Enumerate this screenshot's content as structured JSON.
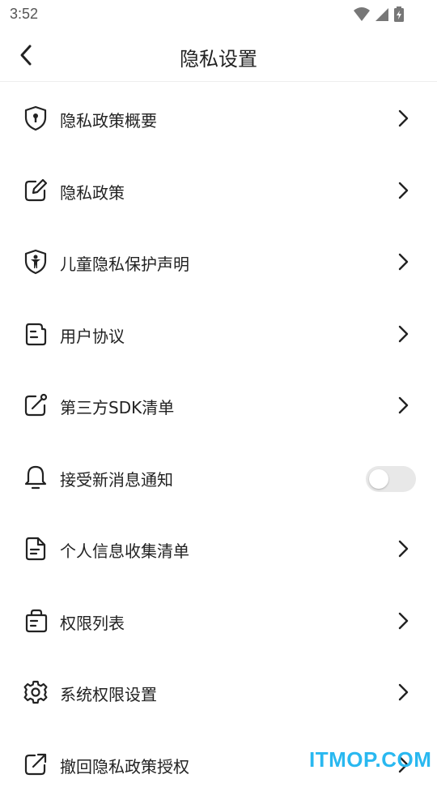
{
  "status_bar": {
    "time": "3:52",
    "icons": [
      "wifi-icon",
      "signal-icon",
      "battery-icon"
    ]
  },
  "header": {
    "back_icon": "chevron-left-icon",
    "title": "隐私设置"
  },
  "settings": {
    "items": [
      {
        "label": "隐私政策概要",
        "icon": "shield-lock-icon",
        "control": "chevron"
      },
      {
        "label": "隐私政策",
        "icon": "edit-note-icon",
        "control": "chevron"
      },
      {
        "label": "儿童隐私保护声明",
        "icon": "child-shield-icon",
        "control": "chevron"
      },
      {
        "label": "用户协议",
        "icon": "document-icon",
        "control": "chevron"
      },
      {
        "label": "第三方SDK清单",
        "icon": "external-edit-icon",
        "control": "chevron"
      },
      {
        "label": "接受新消息通知",
        "icon": "bell-icon",
        "control": "toggle",
        "toggle_on": false
      },
      {
        "label": "个人信息收集清单",
        "icon": "file-list-icon",
        "control": "chevron"
      },
      {
        "label": "权限列表",
        "icon": "bag-icon",
        "control": "chevron"
      },
      {
        "label": "系统权限设置",
        "icon": "gear-icon",
        "control": "chevron"
      },
      {
        "label": "撤回隐私政策授权",
        "icon": "share-out-icon",
        "control": "chevron"
      }
    ]
  },
  "watermark": {
    "text": "ITMOP.COM",
    "color": "#29b8f0"
  },
  "colors": {
    "text": "#222222",
    "toggle_off": "#e8e8e8",
    "divider": "#eeeeee"
  }
}
